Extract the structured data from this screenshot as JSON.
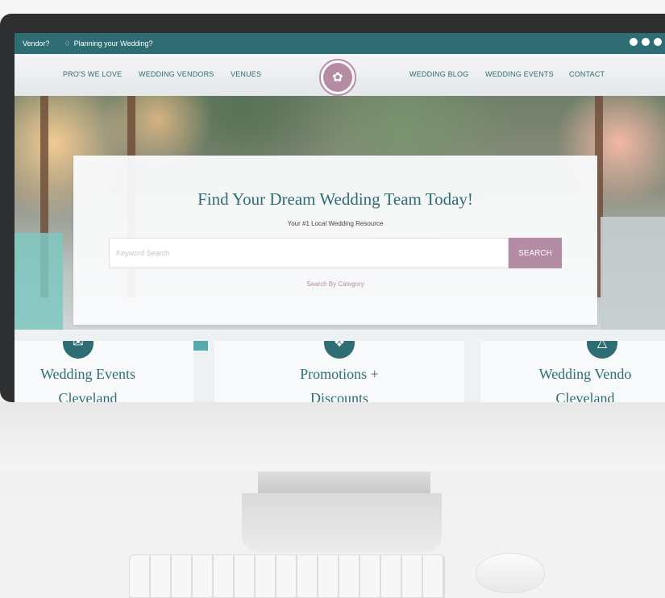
{
  "topbar": {
    "vendor_text": "Vendor?",
    "planning_text": "Planning your Wedding?",
    "social_icons": [
      "facebook-icon",
      "pinterest-icon",
      "instagram-icon"
    ]
  },
  "nav": {
    "left_items": [
      "PRO'S WE LOVE",
      "WEDDING VENDORS",
      "VENUES"
    ],
    "right_items": [
      "WEDDING BLOG",
      "WEDDING EVENTS",
      "CONTACT"
    ],
    "logo_icon": "butterfly-icon"
  },
  "search_card": {
    "title": "Find Your Dream Wedding Team Today!",
    "subtitle": "Your #1 Local Wedding Resource",
    "search_placeholder": "Keyword Search",
    "search_button": "SEARCH",
    "category_link": "Search By Category"
  },
  "features": [
    {
      "title_line1": "Wedding Events",
      "title_line2": "Cleveland",
      "icon": "heart-envelope-icon"
    },
    {
      "title_line1": "Promotions +",
      "title_line2": "Discounts",
      "icon": "tag-icon"
    },
    {
      "title_line1": "Wedding Vendo",
      "title_line2": "Cleveland",
      "icon": "toast-glasses-icon"
    }
  ],
  "colors": {
    "primary_teal": "#2f6d74",
    "accent_mauve": "#b48ca4"
  }
}
